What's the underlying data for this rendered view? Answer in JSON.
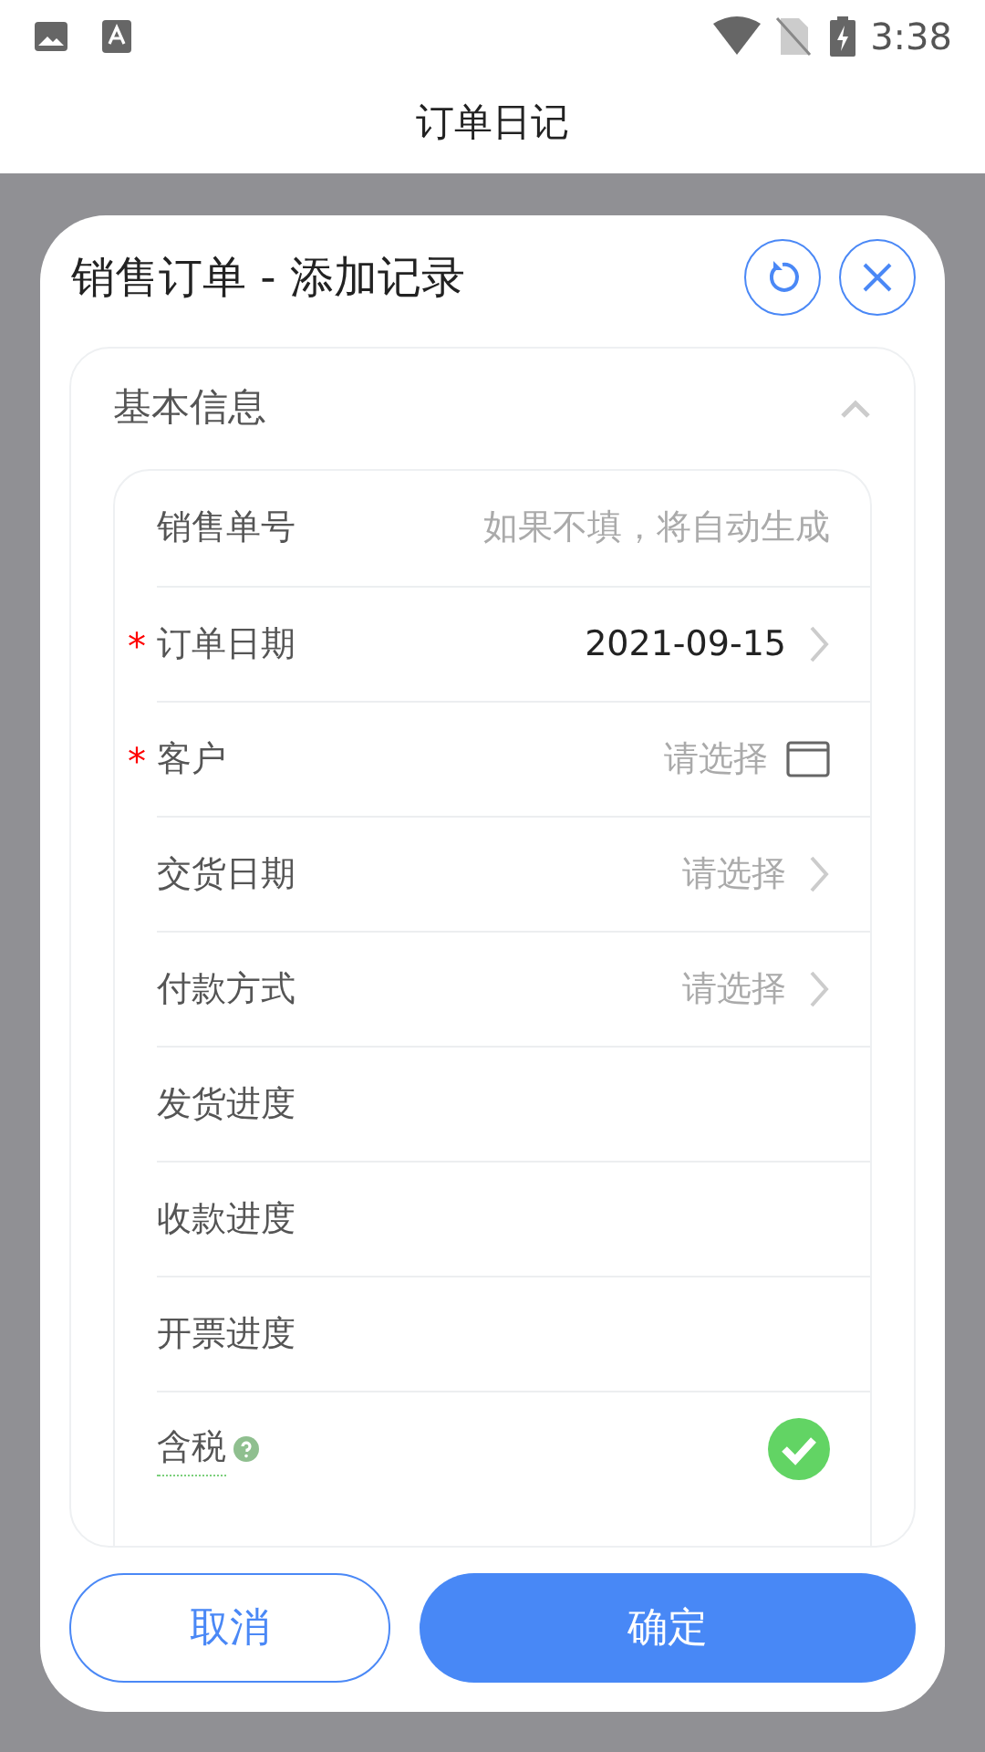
{
  "status_bar": {
    "time": "3:38"
  },
  "header": {
    "title": "订单日记"
  },
  "dialog": {
    "title": "销售订单 - 添加记录",
    "section": {
      "title": "基本信息",
      "expanded": true,
      "fields": [
        {
          "kind": "text",
          "label": "销售单号",
          "placeholder": "如果不填，将自动生成"
        },
        {
          "kind": "picker",
          "label": "订单日期",
          "required_mark": "*",
          "value": "2021-09-15"
        },
        {
          "kind": "window",
          "label": "客户",
          "required_mark": "*",
          "placeholder": "请选择"
        },
        {
          "kind": "picker",
          "label": "交货日期",
          "placeholder": "请选择"
        },
        {
          "kind": "picker",
          "label": "付款方式",
          "placeholder": "请选择"
        },
        {
          "kind": "plain",
          "label": "发货进度"
        },
        {
          "kind": "plain",
          "label": "收款进度"
        },
        {
          "kind": "plain",
          "label": "开票进度"
        },
        {
          "kind": "check",
          "label": "含税",
          "help": true,
          "checked": true
        }
      ]
    },
    "buttons": [
      {
        "kind": "outline",
        "label": "取消"
      },
      {
        "kind": "primary",
        "label": "确定"
      }
    ]
  }
}
